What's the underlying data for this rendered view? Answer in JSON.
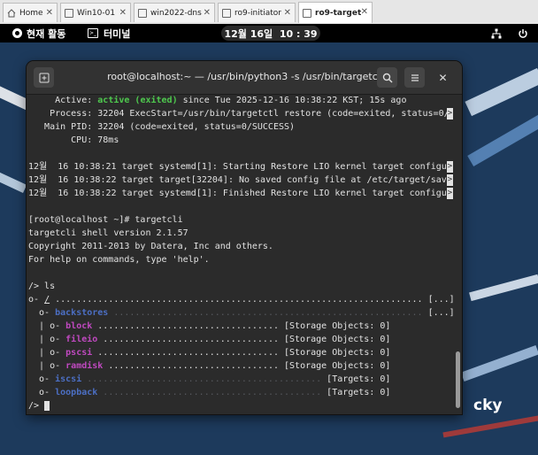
{
  "vm_tabs": [
    {
      "label": "Home",
      "icon": "home-icon",
      "active": false
    },
    {
      "label": "Win10-01",
      "icon": "vm-icon",
      "active": false
    },
    {
      "label": "win2022-dns",
      "icon": "vm-icon",
      "active": false
    },
    {
      "label": "ro9-initiator",
      "icon": "vm-icon",
      "active": false
    },
    {
      "label": "ro9-target",
      "icon": "vm-icon",
      "active": true
    }
  ],
  "topbar": {
    "activities": "현재 활동",
    "terminal_app": "터미널",
    "clock": "12월 16일  10 : 39"
  },
  "terminal": {
    "title": "root@localhost:~ — /usr/bin/python3 -s /usr/bin/targetcli",
    "status": {
      "active_label": "     Active: ",
      "active_value": "active (exited)",
      "active_rest": " since Tue 2025-12-16 10:38:22 KST; 15s ago",
      "process": "    Process: 32204 ExecStart=/usr/bin/targetctl restore (code=exited, status=0/",
      "mainpid": "   Main PID: 32204 (code=exited, status=0/SUCCESS)",
      "cpu": "        CPU: 78ms"
    },
    "journal": [
      "12월  16 10:38:21 target systemd[1]: Starting Restore LIO kernel target configur",
      "12월  16 10:38:22 target target[32204]: No saved config file at /etc/target/save",
      "12월  16 10:38:22 target systemd[1]: Finished Restore LIO kernel target configur"
    ],
    "session": [
      "[root@localhost ~]# targetcli",
      "targetcli shell version 2.1.57",
      "Copyright 2011-2013 by Datera, Inc and others.",
      "For help on commands, type 'help'."
    ],
    "ls_cmd": "/> ls",
    "tree": [
      {
        "prefix": "o- ",
        "name": "/",
        "color": "",
        "dots": " ..................................................................... ",
        "info": "[...]"
      },
      {
        "prefix": "  o- ",
        "name": "backstores",
        "color": "blue",
        "dots": " .......................................................... ",
        "info": "[...]"
      },
      {
        "prefix": "  | o- ",
        "name": "block",
        "color": "magenta",
        "dots": " .................................. ",
        "info": "[Storage Objects: 0]"
      },
      {
        "prefix": "  | o- ",
        "name": "fileio",
        "color": "magenta",
        "dots": " ................................. ",
        "info": "[Storage Objects: 0]"
      },
      {
        "prefix": "  | o- ",
        "name": "pscsi",
        "color": "magenta",
        "dots": " .................................. ",
        "info": "[Storage Objects: 0]"
      },
      {
        "prefix": "  | o- ",
        "name": "ramdisk",
        "color": "magenta",
        "dots": " ................................ ",
        "info": "[Storage Objects: 0]"
      },
      {
        "prefix": "  o- ",
        "name": "iscsi",
        "color": "blue",
        "dots": " ............................................ ",
        "info": "[Targets: 0]"
      },
      {
        "prefix": "  o- ",
        "name": "loopback",
        "color": "blue",
        "dots": " ......................................... ",
        "info": "[Targets: 0]"
      }
    ],
    "prompt": "/> "
  },
  "desktop": {
    "brand_partial": "cky"
  }
}
